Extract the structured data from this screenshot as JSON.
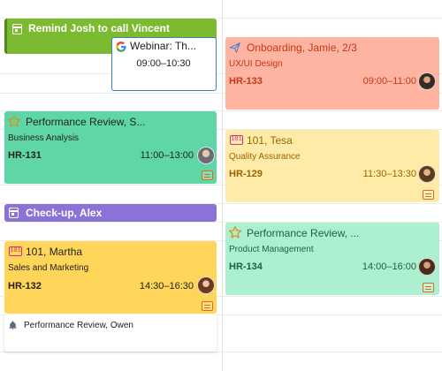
{
  "events": {
    "remind_josh": {
      "title": "Remind Josh to call Vincent",
      "bg": "#7cbb31"
    },
    "webinar": {
      "title": "Webinar: Th...",
      "time": "09:00–10:30",
      "icon": "google-icon"
    },
    "checkup": {
      "title": "Check-up, Alex",
      "bg": "#8a72d6"
    },
    "perf_review_owen": {
      "title": "Performance Review, Owen",
      "icon": "bell-icon"
    },
    "perf_review_s": {
      "title": "Performance Review, S...",
      "subtitle": "Business Analysis",
      "code": "HR-131",
      "time": "11:00–13:00",
      "bg": "#5ed6a6",
      "icon": "star-icon"
    },
    "martha": {
      "title": "101, Martha",
      "subtitle": "Sales and Marketing",
      "code": "HR-132",
      "time": "14:30–16:30",
      "bg": "#ffd55a",
      "icon": "101-icon"
    },
    "onboarding": {
      "title": "Onboarding, Jamie, 2/3",
      "subtitle": "UX/UI Design",
      "code": "HR-133",
      "time": "09:00–11:00",
      "bg": "#ffb3a1",
      "text_color": "#c4381a",
      "icon": "paper-plane-icon"
    },
    "tesa": {
      "title": "101, Tesa",
      "subtitle": "Quality Assurance",
      "code": "HR-129",
      "time": "11:30–13:30",
      "bg": "#ffeba8",
      "text_color": "#9a6500",
      "icon": "101-icon"
    },
    "perf_review_p": {
      "title": "Performance Review, ...",
      "subtitle": "Product Management",
      "code": "HR-134",
      "time": "14:00–16:00",
      "bg": "#acf0cf",
      "text_color": "#1f5f45",
      "icon": "star-icon"
    }
  }
}
